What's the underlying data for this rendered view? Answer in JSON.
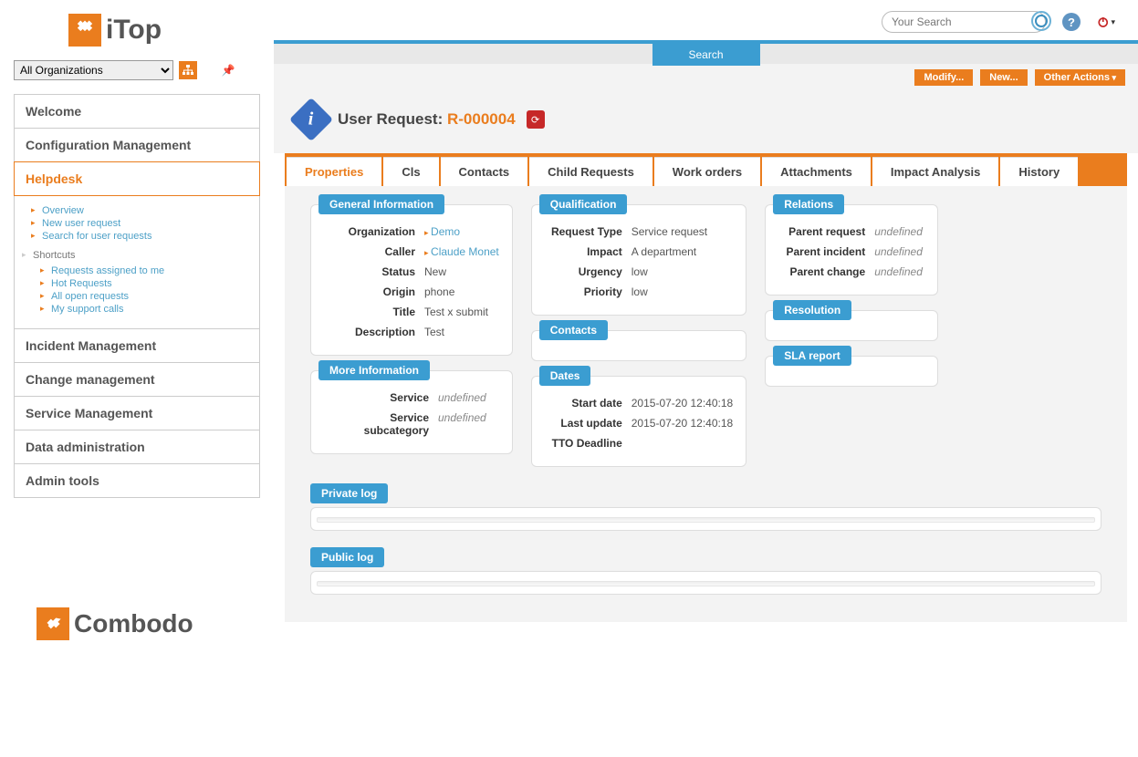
{
  "brand": {
    "name": "iTop",
    "footer": "Combodo"
  },
  "orgSelect": {
    "value": "All Organizations"
  },
  "topbar": {
    "searchPlaceholder": "Your Search"
  },
  "searchBanner": {
    "label": "Search"
  },
  "actions": {
    "modify": "Modify...",
    "new": "New...",
    "other": "Other Actions"
  },
  "header": {
    "prefix": "User Request: ",
    "id": "R-000004"
  },
  "nav": {
    "welcome": "Welcome",
    "config": "Configuration Management",
    "helpdesk": "Helpdesk",
    "incident": "Incident Management",
    "change": "Change management",
    "service": "Service Management",
    "dataadmin": "Data administration",
    "admin": "Admin tools",
    "sub": {
      "overview": "Overview",
      "newreq": "New user request",
      "search": "Search for user requests",
      "shortcuts": "Shortcuts",
      "assigned": "Requests assigned to me",
      "hot": "Hot Requests",
      "allopen": "All open requests",
      "mycalls": "My support calls"
    }
  },
  "tabs": {
    "properties": "Properties",
    "cls": "Cls",
    "contacts": "Contacts",
    "child": "Child Requests",
    "work": "Work orders",
    "attach": "Attachments",
    "impact": "Impact Analysis",
    "history": "History"
  },
  "general": {
    "legend": "General Information",
    "orgLabel": "Organization",
    "orgValue": "Demo",
    "callerLabel": "Caller",
    "callerValue": "Claude Monet",
    "statusLabel": "Status",
    "statusValue": "New",
    "originLabel": "Origin",
    "originValue": "phone",
    "titleLabel": "Title",
    "titleValue": "Test x submit",
    "descLabel": "Description",
    "descValue": "Test"
  },
  "more": {
    "legend": "More Information",
    "serviceLabel": "Service",
    "serviceValue": "undefined",
    "subcatLabel": "Service subcategory",
    "subcatValue": "undefined"
  },
  "qual": {
    "legend": "Qualification",
    "typeLabel": "Request Type",
    "typeValue": "Service request",
    "impactLabel": "Impact",
    "impactValue": "A department",
    "urgencyLabel": "Urgency",
    "urgencyValue": "low",
    "priorityLabel": "Priority",
    "priorityValue": "low"
  },
  "contactsBox": {
    "legend": "Contacts"
  },
  "dates": {
    "legend": "Dates",
    "startLabel": "Start date",
    "startValue": "2015-07-20 12:40:18",
    "lastLabel": "Last update",
    "lastValue": "2015-07-20 12:40:18",
    "ttoLabel": "TTO Deadline",
    "ttoValue": ""
  },
  "rel": {
    "legend": "Relations",
    "preqLabel": "Parent request",
    "preqValue": "undefined",
    "pincLabel": "Parent incident",
    "pincValue": "undefined",
    "pchgLabel": "Parent change",
    "pchgValue": "undefined"
  },
  "resolution": {
    "legend": "Resolution"
  },
  "sla": {
    "legend": "SLA report"
  },
  "privateLog": {
    "legend": "Private log"
  },
  "publicLog": {
    "legend": "Public log"
  }
}
